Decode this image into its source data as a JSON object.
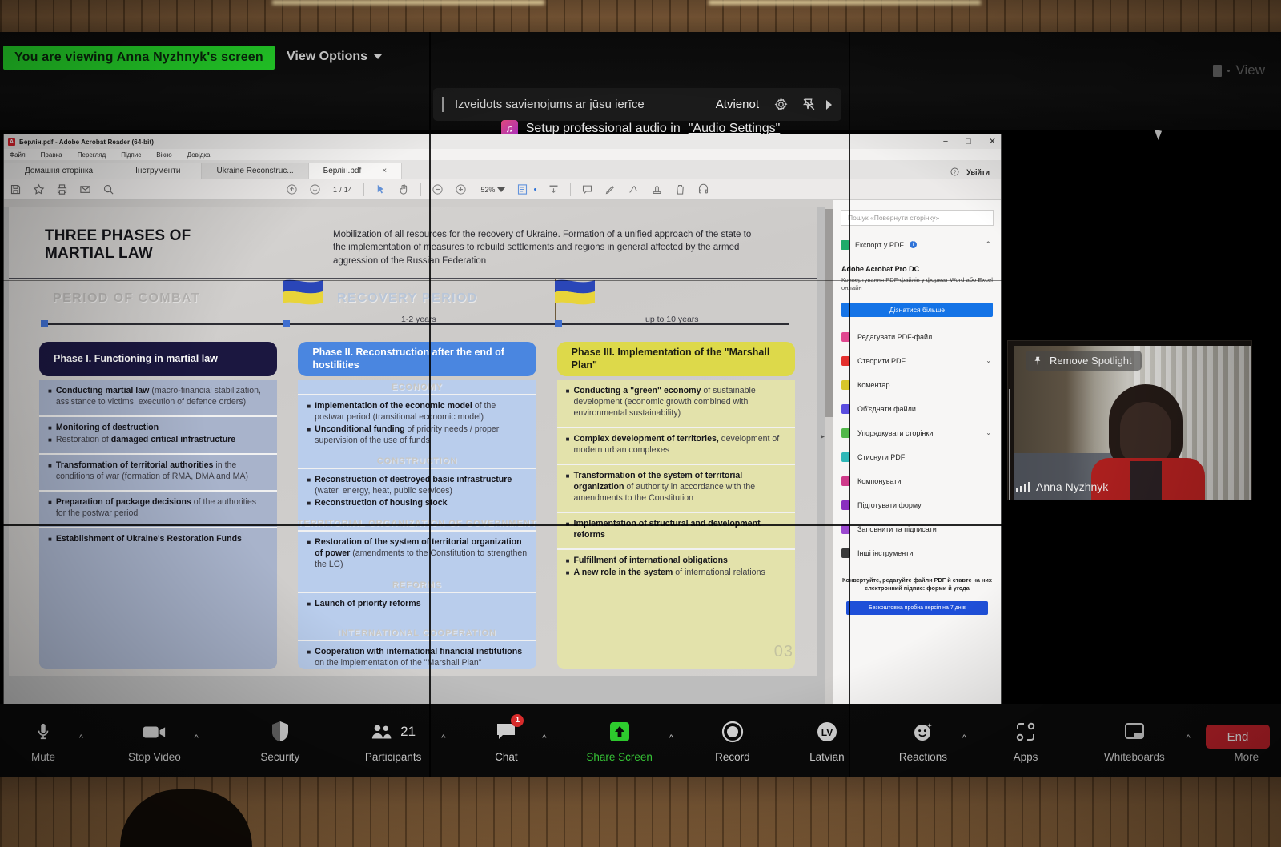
{
  "meeting": {
    "viewing_banner": "You are viewing Anna Nyzhnyk's screen",
    "view_options": "View Options",
    "top_right_view": "View",
    "device_notice": "Izveidots savienojums ar jūsu ierīce",
    "disconnect": "Atvienot",
    "audio_hint_prefix": "Setup professional audio in",
    "audio_hint_link": "\"Audio Settings\"",
    "icons": {
      "gear": "gear-icon",
      "pin_off": "pin-off-icon",
      "chevron_right": "chevron-right-icon",
      "music": "music-note-icon"
    }
  },
  "video_tile": {
    "spotlight_label": "Remove Spotlight",
    "participant_name": "Anna Nyzhnyk",
    "pin_icon": "pin-icon",
    "signal_icon": "signal-bars-icon"
  },
  "zoom_toolbar": {
    "items": [
      {
        "label": "Mute",
        "icon": "microphone-icon",
        "caret": true,
        "badge": "",
        "green": false
      },
      {
        "label": "Stop Video",
        "icon": "camera-icon",
        "caret": true,
        "badge": "",
        "green": false
      },
      {
        "label": "Security",
        "icon": "shield-icon",
        "caret": false,
        "badge": "",
        "green": false
      },
      {
        "label": "Participants",
        "icon": "people-icon",
        "caret": true,
        "badge": "",
        "count": "21",
        "green": false
      },
      {
        "label": "Chat",
        "icon": "chat-bubble-icon",
        "caret": true,
        "badge": "1",
        "green": false
      },
      {
        "label": "Share Screen",
        "icon": "share-screen-icon",
        "caret": true,
        "badge": "",
        "green": true
      },
      {
        "label": "Record",
        "icon": "record-circle-icon",
        "caret": false,
        "badge": "",
        "green": false
      },
      {
        "label": "Latvian",
        "icon": "language-lv-icon",
        "caret": false,
        "badge": "",
        "green": false
      },
      {
        "label": "Reactions",
        "icon": "smiley-icon",
        "caret": true,
        "badge": "",
        "green": false
      },
      {
        "label": "Apps",
        "icon": "apps-icon",
        "caret": false,
        "badge": "",
        "green": false
      },
      {
        "label": "Whiteboards",
        "icon": "whiteboard-icon",
        "caret": true,
        "badge": "",
        "green": false
      },
      {
        "label": "More",
        "icon": "ellipsis-icon",
        "caret": false,
        "badge": "",
        "green": false
      }
    ],
    "end_button": "End"
  },
  "acrobat": {
    "window_title": "Берлін.pdf - Adobe Acrobat Reader (64-bit)",
    "menus": [
      "Файл",
      "Правка",
      "Перегляд",
      "Підпис",
      "Вікно",
      "Довідка"
    ],
    "tabs": [
      {
        "label": "Домашня сторінка",
        "type": "home"
      },
      {
        "label": "Інструменти",
        "type": "tools"
      },
      {
        "label": "Ukraine Reconstruc...",
        "type": "doc"
      },
      {
        "label": "Берлін.pdf",
        "type": "active",
        "close": "×"
      }
    ],
    "sign_in": "Увійти",
    "window_controls": {
      "minimize": "−",
      "maximize": "□",
      "close": "✕"
    },
    "toolbar": {
      "page_indicator": "1 / 14",
      "zoom_level": "52%",
      "icons": [
        "save-icon",
        "star-icon",
        "print-icon",
        "email-icon",
        "search-icon",
        "scroll-up-icon",
        "scroll-down-icon",
        "select-tool-icon",
        "hand-tool-icon",
        "zoom-out-icon",
        "zoom-in-icon",
        "fit-page-icon",
        "page-fit-icon",
        "comment-icon",
        "highlight-icon",
        "sign-icon",
        "stamp-icon",
        "delete-icon",
        "read-aloud-icon"
      ]
    },
    "tools_panel": {
      "search_placeholder": "Пошук «Повернути сторінку»",
      "export_label": "Експорт у PDF",
      "promo_title": "Adobe Acrobat Pro DC",
      "promo_sub": "Конвертування PDF-файлів у формат Word або Excel онлайн",
      "cta": "Дізнатися більше",
      "items": [
        {
          "label": "Редагувати PDF-файл",
          "color": "#e0478f",
          "caret": false
        },
        {
          "label": "Створити PDF",
          "color": "#e5302e",
          "caret": true
        },
        {
          "label": "Коментар",
          "color": "#d8c52a",
          "caret": false
        },
        {
          "label": "Об'єднати файли",
          "color": "#5b4de0",
          "caret": false
        },
        {
          "label": "Упорядкувати сторінки",
          "color": "#52b84a",
          "caret": true
        },
        {
          "label": "Стиснути PDF",
          "color": "#2fb7b7",
          "caret": false
        },
        {
          "label": "Компонувати",
          "color": "#cf3a8a",
          "caret": false
        },
        {
          "label": "Підготувати форму",
          "color": "#8a2fc0",
          "caret": false
        },
        {
          "label": "Заповнити та підписати",
          "color": "#8a2fc0",
          "caret": false
        },
        {
          "label": "Інші інструменти",
          "color": "#2b2b2b",
          "caret": false
        }
      ],
      "footer": "Конвертуйте, редагуйте файли PDF й ставте на них електронний підпис: форми й угода",
      "trial_button": "Безкоштовна пробна версія на 7 днів"
    }
  },
  "slide": {
    "title": "THREE PHASES OF\nMARTIAL LAW",
    "intro": "Mobilization of all resources for the recovery of Ukraine. Formation of a unified approach of the state to the implementation of measures to rebuild settlements and regions in general affected by the armed aggression of the Russian Federation",
    "timeline": {
      "period_combat": "PERIOD OF COMBAT",
      "period_recovery": "RECOVERY PERIOD",
      "duration_1": "1-2 years",
      "duration_2": "up to 10 years"
    },
    "slide_number": "03",
    "section_headers": [
      "ECONOMY",
      "CONSTRUCTION",
      "TERRITORIAL ORGANIZATION OF GOVERNMENT",
      "REFORMS",
      "INTERNATIONAL COOPERATION"
    ],
    "phases": [
      {
        "heading": "Phase I. Functioning in martial law",
        "blocks": [
          {
            "bullets": [
              {
                "bold": "Conducting martial law",
                "rest": " (macro-financial stabilization, assistance to victims, execution of defence orders)"
              }
            ]
          },
          {
            "bullets": [
              {
                "bold": "Monitoring of destruction",
                "rest": ""
              },
              {
                "bold": "",
                "pre": "Restoration of ",
                "rest2": "damaged critical infrastructure"
              }
            ]
          },
          {
            "bullets": [
              {
                "bold": "Transformation of territorial authorities",
                "rest": " in the conditions of war (formation of RMA, DMA and MA)"
              }
            ]
          },
          {
            "bullets": [
              {
                "bold": "Preparation of package decisions",
                "rest": " of the authorities for the postwar period"
              }
            ]
          },
          {
            "bullets": [
              {
                "bold": "Establishment of Ukraine's Restoration Funds",
                "rest": ""
              }
            ]
          }
        ]
      },
      {
        "heading": "Phase II. Reconstruction after the end of hostilities",
        "blocks": [
          {
            "bullets": [
              {
                "bold": "Implementation of the economic model",
                "rest": " of the postwar period (transitional economic model)"
              },
              {
                "bold": "Unconditional funding",
                "rest": " of priority needs / proper supervision of the use of funds"
              }
            ]
          },
          {
            "bullets": [
              {
                "bold": "Reconstruction of destroyed basic infrastructure",
                "rest": " (water, energy, heat, public services)"
              },
              {
                "bold": "Reconstruction of housing stock",
                "rest": ""
              }
            ]
          },
          {
            "bullets": [
              {
                "bold": "Restoration of the system of territorial organization of power",
                "rest": " (amendments to the Constitution to strengthen the LG)"
              }
            ]
          },
          {
            "bullets": [
              {
                "bold": "Launch of priority reforms",
                "rest": ""
              }
            ]
          },
          {
            "bullets": [
              {
                "bold": "Cooperation with international financial institutions",
                "rest": " on the implementation of the \"Marshall Plan\""
              }
            ]
          }
        ]
      },
      {
        "heading": "Phase III. Implementation of the \"Marshall Plan\"",
        "blocks": [
          {
            "bullets": [
              {
                "bold": "Conducting a \"green\" economy",
                "rest": " of sustainable development (economic growth combined with environmental sustainability)"
              }
            ]
          },
          {
            "bullets": [
              {
                "bold": "Complex development of territories,",
                "rest": " development of modern urban complexes"
              }
            ]
          },
          {
            "bullets": [
              {
                "bold": "Transformation of the system of territorial organization",
                "rest": " of authority in accordance with the amendments to the Constitution"
              }
            ]
          },
          {
            "bullets": [
              {
                "bold": "Implementation of structural and development reforms",
                "rest": ""
              }
            ]
          },
          {
            "bullets": [
              {
                "bold": "Fulfillment of international obligations",
                "rest": ""
              },
              {
                "bold": "A new role in the system",
                "rest": " of international relations"
              }
            ]
          }
        ]
      }
    ]
  }
}
